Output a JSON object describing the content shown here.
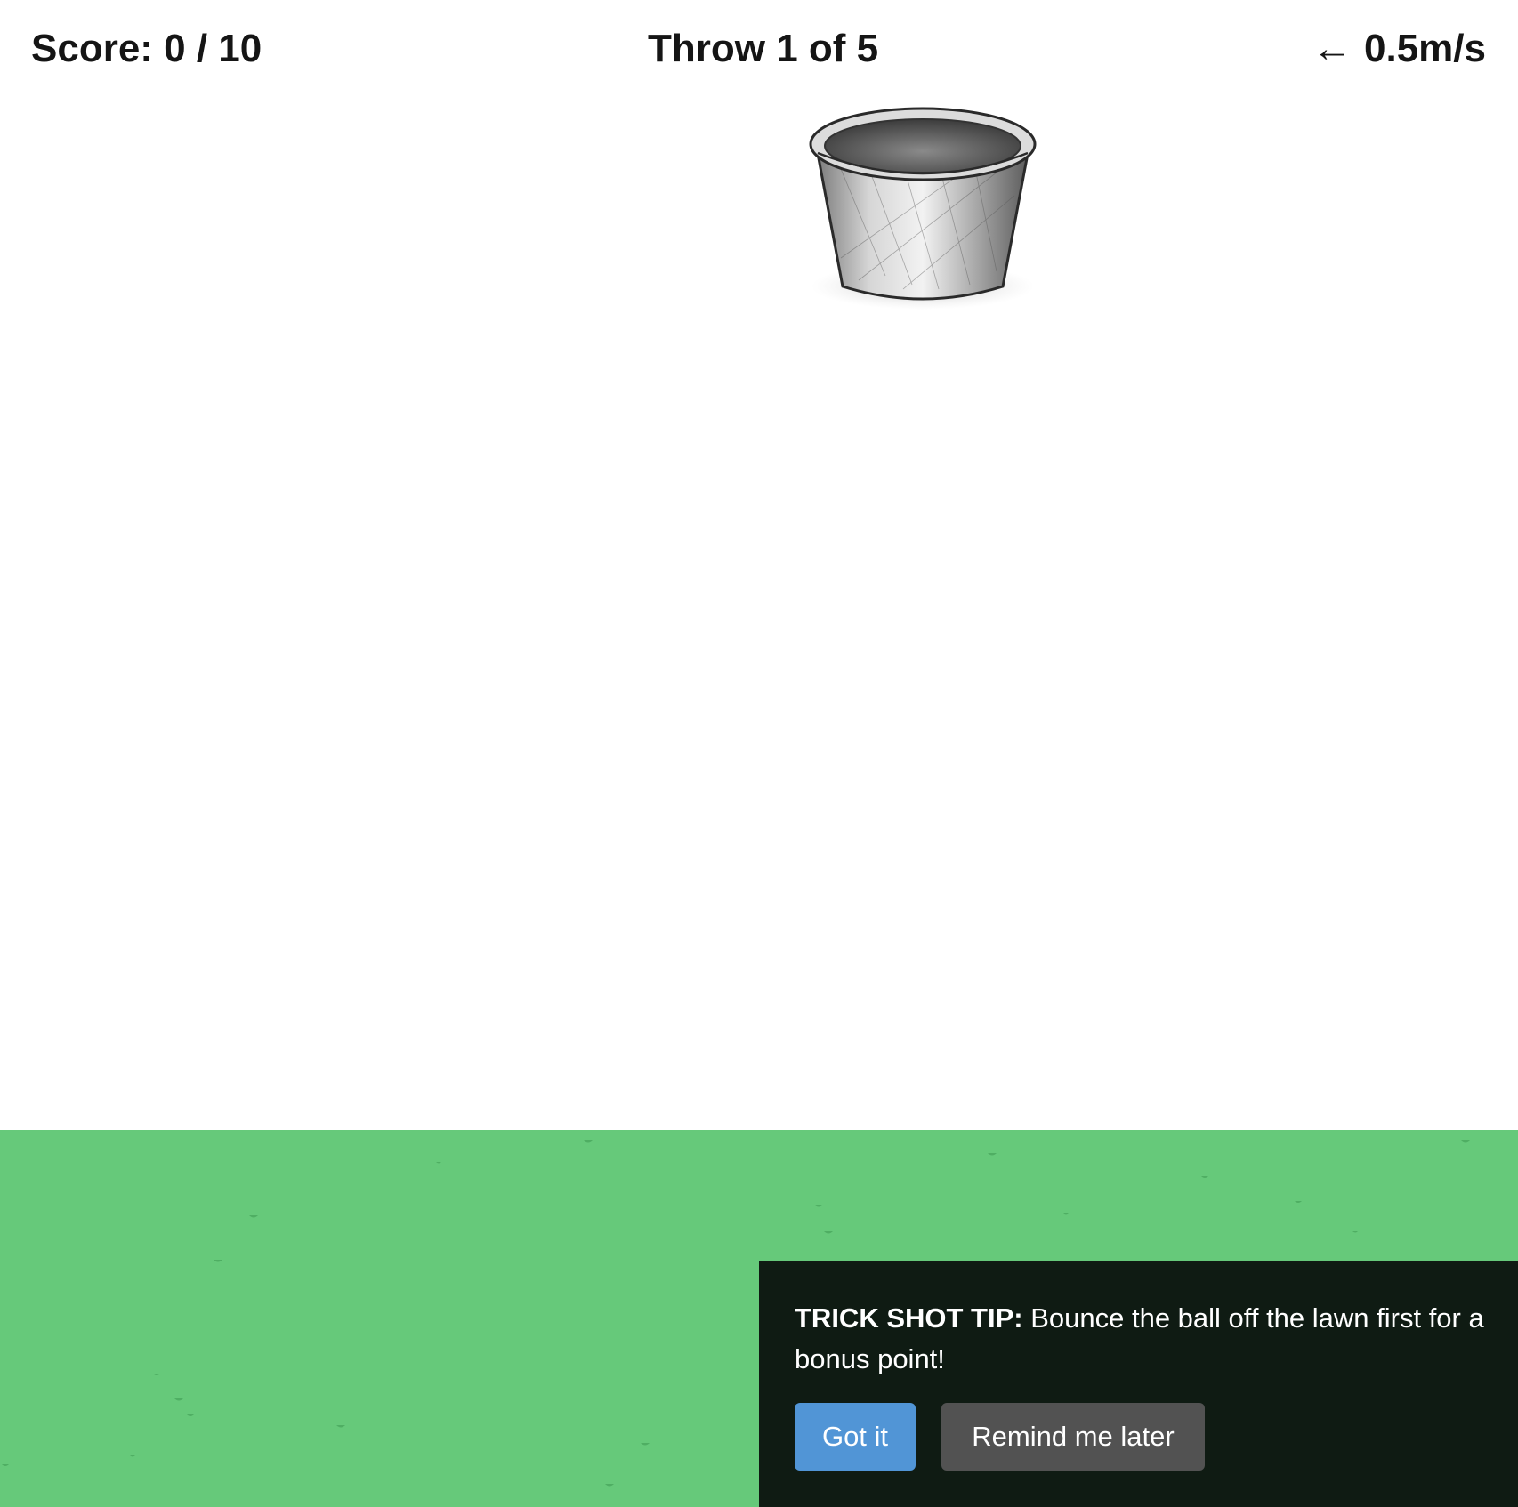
{
  "hud": {
    "score": "Score: 0 / 10",
    "throw": "Throw 1 of 5",
    "wind_arrow": "←",
    "wind": "0.5m/s"
  },
  "tip": {
    "label": "TRICK SHOT TIP:",
    "text": " Bounce the ball off the lawn first for a bonus point!",
    "primary_button": "Got it",
    "secondary_button": "Remind me later"
  },
  "colors": {
    "lawn": "#66c97a",
    "panel": "#0f1b13",
    "primary_button": "#5195d6",
    "secondary_button": "#525252"
  },
  "icons": {
    "target": "bucket-icon",
    "wind": "left-arrow-icon"
  }
}
